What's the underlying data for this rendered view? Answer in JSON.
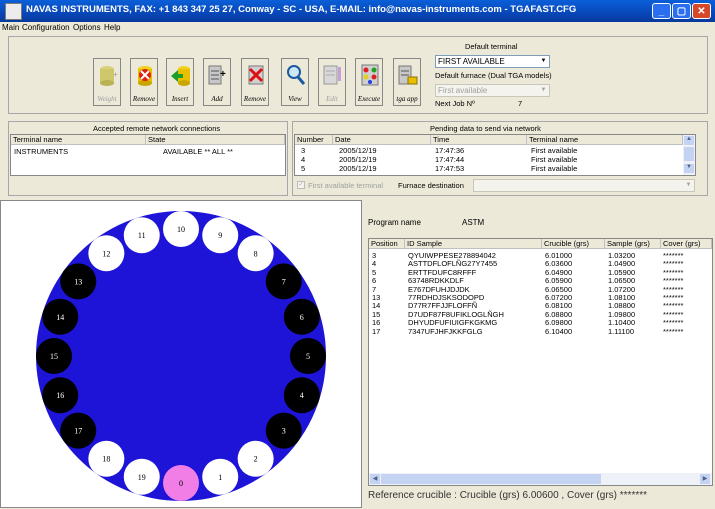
{
  "window": {
    "title": "NAVAS INSTRUMENTS, FAX: +1 843 347 25 27, Conway - SC - USA, E-MAIL: info@navas-instruments.com - TGAFAST.CFG"
  },
  "menu": [
    "Main",
    "Configuration",
    "Options",
    "Help"
  ],
  "toolbar": {
    "buttons": [
      {
        "label": "Weight",
        "icon": "weight-icon",
        "enabled": false
      },
      {
        "label": "Remove",
        "icon": "remove-icon",
        "enabled": true
      },
      {
        "label": "Insert",
        "icon": "insert-icon",
        "enabled": true
      },
      {
        "label": "Add",
        "icon": "add-icon",
        "enabled": true
      },
      {
        "label": "Remove",
        "icon": "remove-job-icon",
        "enabled": true
      },
      {
        "label": "View",
        "icon": "view-icon",
        "enabled": true
      },
      {
        "label": "Edit",
        "icon": "edit-icon",
        "enabled": false
      },
      {
        "label": "Execute",
        "icon": "execute-icon",
        "enabled": true
      },
      {
        "label": "tga app",
        "icon": "tga-app-icon",
        "enabled": true
      }
    ],
    "default_terminal_label": "Default terminal",
    "default_terminal_value": "FIRST AVAILABLE",
    "default_furnace_label": "Default furnace (Dual TGA models)",
    "default_furnace_value": "First available",
    "next_job_label": "Next Job Nº",
    "next_job_value": "7"
  },
  "connections": {
    "title": "Accepted remote network connections",
    "columns": [
      "Terminal name",
      "State"
    ],
    "rows": [
      {
        "terminal": "INSTRUMENTS",
        "state": "AVAILABLE  ** ALL **"
      }
    ]
  },
  "pending": {
    "title": "Pending data to send via network",
    "columns": [
      "Number",
      "Date",
      "Time",
      "Terminal name"
    ],
    "rows": [
      {
        "number": "3",
        "date": "2005/12/19",
        "time": "17:47:36",
        "terminal": "First available"
      },
      {
        "number": "4",
        "date": "2005/12/19",
        "time": "17:47:44",
        "terminal": "First available"
      },
      {
        "number": "5",
        "date": "2005/12/19",
        "time": "17:47:53",
        "terminal": "First available"
      }
    ],
    "first_available_checkbox": "First available terminal",
    "furnace_destination_label": "Furnace destination"
  },
  "carousel": {
    "positions": [
      {
        "n": "0",
        "state": "selected"
      },
      {
        "n": "1",
        "state": "empty"
      },
      {
        "n": "2",
        "state": "empty"
      },
      {
        "n": "3",
        "state": "loaded"
      },
      {
        "n": "4",
        "state": "loaded"
      },
      {
        "n": "5",
        "state": "loaded"
      },
      {
        "n": "6",
        "state": "loaded"
      },
      {
        "n": "7",
        "state": "loaded"
      },
      {
        "n": "8",
        "state": "empty"
      },
      {
        "n": "9",
        "state": "empty"
      },
      {
        "n": "10",
        "state": "empty"
      },
      {
        "n": "11",
        "state": "empty"
      },
      {
        "n": "12",
        "state": "empty"
      },
      {
        "n": "13",
        "state": "loaded"
      },
      {
        "n": "14",
        "state": "loaded"
      },
      {
        "n": "15",
        "state": "loaded"
      },
      {
        "n": "16",
        "state": "loaded"
      },
      {
        "n": "17",
        "state": "loaded"
      },
      {
        "n": "18",
        "state": "empty"
      },
      {
        "n": "19",
        "state": "empty"
      }
    ],
    "colors": {
      "ring": "#1d14d8",
      "empty": "#ffffff",
      "loaded": "#000000",
      "selected": "#f07ee6"
    }
  },
  "program": {
    "label": "Program name",
    "value": "ASTM",
    "columns": [
      "Position",
      "ID Sample",
      "Crucible (grs)",
      "Sample (grs)",
      "Cover (grs)"
    ],
    "rows": [
      {
        "pos": "3",
        "id": "QYUIWPPESE278894042",
        "crucible": "6.01000",
        "sample": "1.03200",
        "cover": "*******"
      },
      {
        "pos": "4",
        "id": "ASTTDFLOFLÑG27Y7455",
        "crucible": "6.03600",
        "sample": "1.04900",
        "cover": "*******"
      },
      {
        "pos": "5",
        "id": "ERTTFDUFC8RFFF",
        "crucible": "6.04900",
        "sample": "1.05900",
        "cover": "*******"
      },
      {
        "pos": "6",
        "id": "63748RDKKDLF",
        "crucible": "6.05900",
        "sample": "1.06500",
        "cover": "*******"
      },
      {
        "pos": "7",
        "id": "E767DFUHJDJDK",
        "crucible": "6.06500",
        "sample": "1.07200",
        "cover": "*******"
      },
      {
        "pos": "13",
        "id": "77RDHDJSKSODOPD",
        "crucible": "6.07200",
        "sample": "1.08100",
        "cover": "*******"
      },
      {
        "pos": "14",
        "id": "D77R7FFJJFLOFFÑ",
        "crucible": "6.08100",
        "sample": "1.08800",
        "cover": "*******"
      },
      {
        "pos": "15",
        "id": "D7UDF87F8UFIKLOGLÑGH",
        "crucible": "6.08800",
        "sample": "1.09800",
        "cover": "*******"
      },
      {
        "pos": "16",
        "id": "DHYUDFUFIUIGFKGKMG",
        "crucible": "6.09800",
        "sample": "1.10400",
        "cover": "*******"
      },
      {
        "pos": "17",
        "id": "7347UFJHFJKKFGLG",
        "crucible": "6.10400",
        "sample": "1.11100",
        "cover": "*******"
      }
    ],
    "reference": "Reference crucible : Crucible (grs)  6.00600 , Cover (grs) *******"
  }
}
